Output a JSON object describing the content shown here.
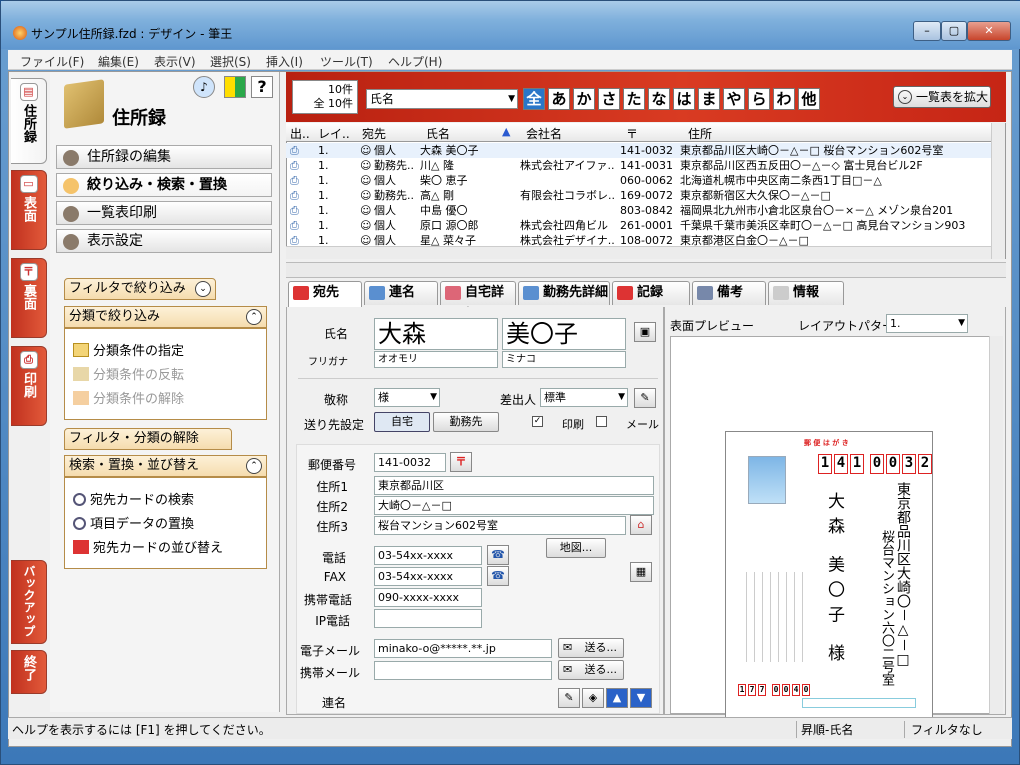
{
  "window": {
    "title": "サンプル住所録.fzd : デザイン - 筆王"
  },
  "menu": [
    "ファイル(F)",
    "編集(E)",
    "表示(V)",
    "選択(S)",
    "挿入(I)",
    "ツール(T)",
    "ヘルプ(H)"
  ],
  "side_tabs": [
    {
      "label": "住所録"
    },
    {
      "label": "表面"
    },
    {
      "label": "裏面"
    },
    {
      "label": "印刷"
    },
    {
      "label": "バックアップ"
    },
    {
      "label": "終了"
    }
  ],
  "left": {
    "header": "住所録",
    "nav": [
      "住所録の編集",
      "絞り込み・検索・置換",
      "一覧表印刷",
      "表示設定"
    ],
    "filter_tab": "フィルタで絞り込み",
    "category_panel": {
      "title": "分類で絞り込み",
      "items": [
        "分類条件の指定",
        "分類条件の反転",
        "分類条件の解除"
      ]
    },
    "clear_tab": "フィルタ・分類の解除",
    "search_panel": {
      "title": "検索・置換・並び替え",
      "items": [
        "宛先カードの検索",
        "項目データの置換",
        "宛先カードの並び替え"
      ]
    }
  },
  "toolbar": {
    "count_line1": "10件",
    "count_line2": "全 10件",
    "sort_field": "氏名",
    "kana": [
      "全",
      "あ",
      "か",
      "さ",
      "た",
      "な",
      "は",
      "ま",
      "や",
      "ら",
      "わ",
      "他"
    ],
    "expand_label": "一覧表を拡大"
  },
  "grid": {
    "headers": [
      "出..",
      "レイ..",
      "宛先",
      "氏名",
      "会社名",
      "〒",
      "住所"
    ],
    "rows": [
      {
        "n": "1.",
        "type": "個人",
        "name": "大森 美〇子",
        "company": "",
        "zip": "141-0032",
        "addr": "東京都品川区大崎〇－△－□ 桜台マンション602号室"
      },
      {
        "n": "1.",
        "type": "勤務先..",
        "name": "川△ 隆",
        "company": "株式会社アイファ..",
        "zip": "141-0031",
        "addr": "東京都品川区西五反田〇－△－◇ 富士見台ビル2F"
      },
      {
        "n": "1.",
        "type": "個人",
        "name": "柴〇 恵子",
        "company": "",
        "zip": "060-0062",
        "addr": "北海道札幌市中央区南二条西1丁目□－△"
      },
      {
        "n": "1.",
        "type": "勤務先..",
        "name": "高△ 剛",
        "company": "有限会社コラボレ..",
        "zip": "169-0072",
        "addr": "東京都新宿区大久保〇－△－□"
      },
      {
        "n": "1.",
        "type": "個人",
        "name": "中島 優〇",
        "company": "",
        "zip": "803-0842",
        "addr": "福岡県北九州市小倉北区泉台〇－×－△ メゾン泉台201"
      },
      {
        "n": "1.",
        "type": "個人",
        "name": "原口 源〇郎",
        "company": "株式会社四角ビル",
        "zip": "261-0001",
        "addr": "千葉県千葉市美浜区幸町〇－△－□ 高見台マンション903"
      },
      {
        "n": "1.",
        "type": "個人",
        "name": "星△ 菜々子",
        "company": "株式会社デザイナ..",
        "zip": "108-0072",
        "addr": "東京都港区白金〇－△－□"
      }
    ]
  },
  "tabs": [
    "宛先",
    "連名",
    "自宅詳細",
    "勤務先詳細",
    "記録",
    "備考",
    "情報"
  ],
  "form": {
    "name_label": "氏名",
    "last_name": "大森",
    "first_name": "美〇子",
    "kana_label": "フリガナ",
    "last_kana": "オオモリ",
    "first_kana": "ミナコ",
    "honorific_label": "敬称",
    "honorific": "様",
    "sender_label": "差出人",
    "sender": "標準",
    "dest_label": "送り先設定",
    "home": "自宅",
    "work": "勤務先",
    "print_label": "印刷",
    "mail_label": "メール",
    "zip_label": "郵便番号",
    "zip": "141-0032",
    "addr1_label": "住所1",
    "addr1": "東京都品川区",
    "addr2_label": "住所2",
    "addr2": "大崎〇－△－□",
    "addr3_label": "住所3",
    "addr3": "桜台マンション602号室",
    "map_label": "地図...",
    "tel_label": "電話",
    "tel": "03-54xx-xxxx",
    "fax_label": "FAX",
    "fax": "03-54xx-xxxx",
    "mobile_label": "携帯電話",
    "mobile": "090-xxxx-xxxx",
    "ip_label": "IP電話",
    "ip": "",
    "email_label": "電子メール",
    "email": "minako-o@*****.**.jp",
    "mobile_mail_label": "携帯メール",
    "mobile_mail": "",
    "send_label": "送る...",
    "joint_label": "連名"
  },
  "preview": {
    "label": "表面プレビュー",
    "layout_label": "レイアウトパターン",
    "layout_value": "1.",
    "card_title": "郵 便 は が き",
    "zip_digits": [
      "1",
      "4",
      "1",
      "0",
      "0",
      "3",
      "2"
    ],
    "addr_line1": "東京都品川区大崎〇－△－□",
    "addr_line2": "桜台マンション六〇二号室",
    "recipient": "大森 美〇子 様",
    "sender_zip": [
      "1",
      "7",
      "7",
      "0",
      "0",
      "4",
      "0"
    ]
  },
  "status": {
    "help": "ヘルプを表示するには [F1] を押してください。",
    "sort": "昇順-氏名",
    "filter": "フィルタなし"
  }
}
